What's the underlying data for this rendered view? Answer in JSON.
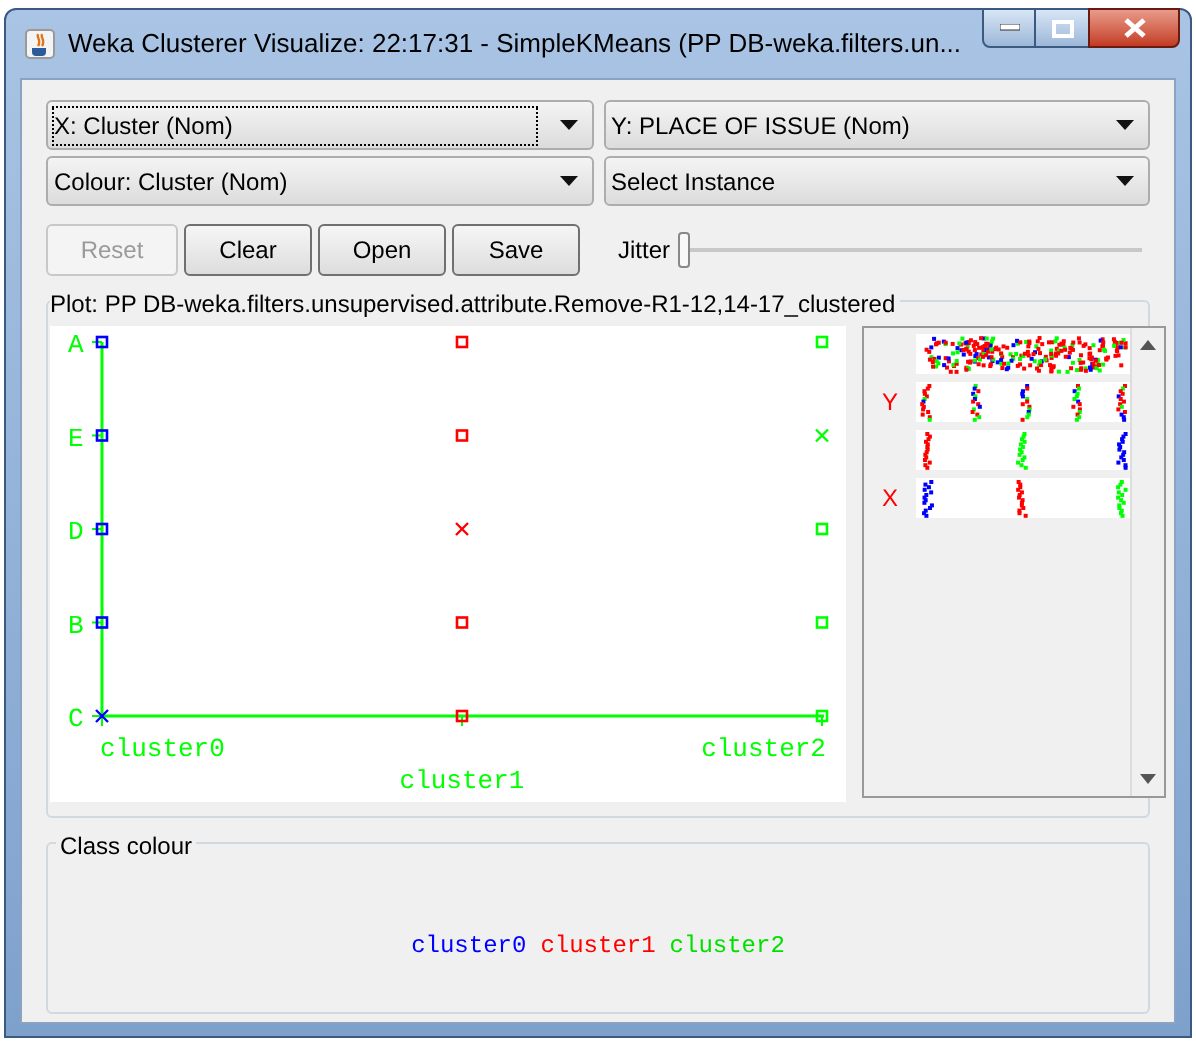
{
  "window": {
    "title": "Weka Clusterer Visualize: 22:17:31 - SimpleKMeans (PP DB-weka.filters.un..."
  },
  "selectors": [
    {
      "label": "X: Cluster (Nom)",
      "focused": true
    },
    {
      "label": "Y: PLACE OF ISSUE (Nom)",
      "focused": false
    },
    {
      "label": "Colour: Cluster (Nom)",
      "focused": false
    },
    {
      "label": "Select Instance",
      "focused": false
    }
  ],
  "buttons": [
    {
      "label": "Reset",
      "disabled": true
    },
    {
      "label": "Clear",
      "disabled": false
    },
    {
      "label": "Open",
      "disabled": false
    },
    {
      "label": "Save",
      "disabled": false
    }
  ],
  "jitter": {
    "label": "Jitter",
    "level": 0
  },
  "plot": {
    "title": "Plot: PP DB-weka.filters.unsupervised.attribute.Remove-R1-12,14-17_clustered",
    "y_labels": [
      "A",
      "E",
      "D",
      "B",
      "C"
    ],
    "columns": [
      {
        "label": "cluster0",
        "points": [
          {
            "kind": "square",
            "color": "#0000ff"
          },
          {
            "kind": "square",
            "color": "#0000ff"
          },
          {
            "kind": "square",
            "color": "#0000ff"
          },
          {
            "kind": "square",
            "color": "#0000ff"
          },
          {
            "kind": "cross",
            "color": "#0000ff"
          }
        ]
      },
      {
        "label": "cluster1",
        "points": [
          {
            "kind": "square",
            "color": "#ff0000"
          },
          {
            "kind": "square",
            "color": "#ff0000"
          },
          {
            "kind": "cross",
            "color": "#ff0000"
          },
          {
            "kind": "square",
            "color": "#ff0000"
          },
          {
            "kind": "square",
            "color": "#ff0000"
          }
        ]
      },
      {
        "label": "cluster2",
        "points": [
          {
            "kind": "square",
            "color": "#00ff00"
          },
          {
            "kind": "cross",
            "color": "#00ff00"
          },
          {
            "kind": "square",
            "color": "#00ff00"
          },
          {
            "kind": "square",
            "color": "#00ff00"
          },
          {
            "kind": "square",
            "color": "#00ff00"
          }
        ]
      }
    ]
  },
  "matrix": {
    "rows": [
      {
        "kind": "picture"
      },
      {
        "kind": "picture",
        "label": "Y"
      },
      {
        "kind": "picture"
      },
      {
        "kind": "picture",
        "label": "X"
      }
    ]
  },
  "class_colour": {
    "title": "Class colour",
    "items": [
      {
        "label": "cluster0",
        "color": "#0000ff"
      },
      {
        "label": "cluster1",
        "color": "#ff0000"
      },
      {
        "label": "cluster2",
        "color": "#00e000"
      }
    ]
  }
}
